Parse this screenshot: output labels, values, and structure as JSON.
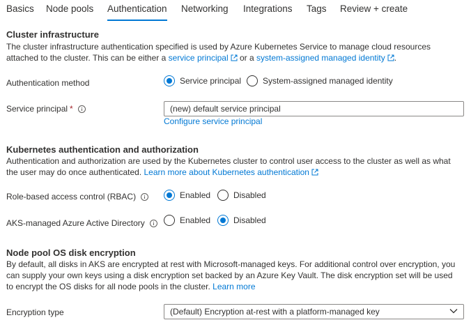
{
  "tabs": [
    {
      "label": "Basics"
    },
    {
      "label": "Node pools"
    },
    {
      "label": "Authentication",
      "active": true
    },
    {
      "label": "Networking"
    },
    {
      "label": "Integrations"
    },
    {
      "label": "Tags"
    },
    {
      "label": "Review + create"
    }
  ],
  "cluster_infra": {
    "title": "Cluster infrastructure",
    "desc_1": "The cluster infrastructure authentication specified is used by Azure Kubernetes Service to manage cloud resources attached to the cluster. This can be either a ",
    "link_sp": "service principal",
    "desc_2": " or a ",
    "link_smi": "system-assigned managed identity",
    "desc_3": ".",
    "auth_method_label": "Authentication method",
    "auth_options": [
      {
        "label": "Service principal",
        "checked": true
      },
      {
        "label": "System-assigned managed identity",
        "checked": false
      }
    ],
    "sp_label": "Service principal",
    "sp_required_mark": "*",
    "sp_value": "(new) default service principal",
    "configure_link": "Configure service principal"
  },
  "k8s_auth": {
    "title": "Kubernetes authentication and authorization",
    "desc": "Authentication and authorization are used by the Kubernetes cluster to control user access to the cluster as well as what the user may do once authenticated. ",
    "learn_more": "Learn more about Kubernetes authentication",
    "rbac_label": "Role-based access control (RBAC)",
    "rbac_options": [
      {
        "label": "Enabled",
        "checked": true
      },
      {
        "label": "Disabled",
        "checked": false
      }
    ],
    "aad_label": "AKS-managed Azure Active Directory",
    "aad_options": [
      {
        "label": "Enabled",
        "checked": false
      },
      {
        "label": "Disabled",
        "checked": true
      }
    ]
  },
  "encryption": {
    "title": "Node pool OS disk encryption",
    "desc": "By default, all disks in AKS are encrypted at rest with Microsoft-managed keys. For additional control over encryption, you can supply your own keys using a disk encryption set backed by an Azure Key Vault. The disk encryption set will be used to encrypt the OS disks for all node pools in the cluster. ",
    "learn_more": "Learn more",
    "type_label": "Encryption type",
    "type_value": "(Default) Encryption at-rest with a platform-managed key"
  },
  "icons": {
    "external": "external-link-icon",
    "info": "info-icon",
    "dropdown": "chevron-down-icon"
  },
  "colors": {
    "accent": "#0078d4",
    "required": "#a4262c",
    "text": "#323130"
  }
}
